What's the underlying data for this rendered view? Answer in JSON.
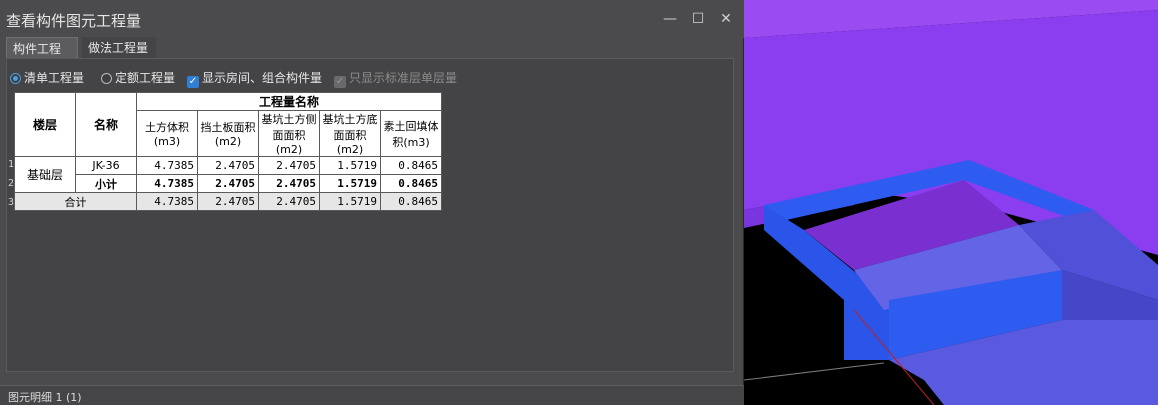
{
  "window": {
    "title": "查看构件图元工程量",
    "minimize_glyph": "—",
    "maximize_glyph": "☐",
    "close_glyph": "✕"
  },
  "tabs": [
    {
      "label": "构件工程量",
      "active": true
    },
    {
      "label": "做法工程量",
      "active": false
    }
  ],
  "options": {
    "radio_bill": "清单工程量",
    "radio_quota": "定额工程量",
    "check_show_rooms": "显示房间、组合构件量",
    "check_standard_only": "只显示标准层单层量"
  },
  "table": {
    "header_floor": "楼层",
    "header_name": "名称",
    "header_group": "工程量名称",
    "columns": [
      "土方体积(m3)",
      "挡土板面积(m2)",
      "基坑土方侧面面积(m2)",
      "基坑土方底面面积(m2)",
      "素土回填体积(m3)"
    ],
    "row_numbers": [
      "1",
      "2",
      "3"
    ],
    "floor": "基础层",
    "rows": [
      {
        "name": "JK-36",
        "values": [
          "4.7385",
          "2.4705",
          "2.4705",
          "1.5719",
          "0.8465"
        ]
      },
      {
        "name": "小计",
        "values": [
          "4.7385",
          "2.4705",
          "2.4705",
          "1.5719",
          "0.8465"
        ]
      }
    ],
    "total": {
      "label": "合计",
      "values": [
        "4.7385",
        "2.4705",
        "2.4705",
        "1.5719",
        "0.8465"
      ]
    }
  },
  "status": {
    "label": "图元明细  1 (1)"
  },
  "colors": {
    "purple": "#8a3ef0",
    "blue": "#2f5cf0",
    "lavender": "#6464e6"
  }
}
